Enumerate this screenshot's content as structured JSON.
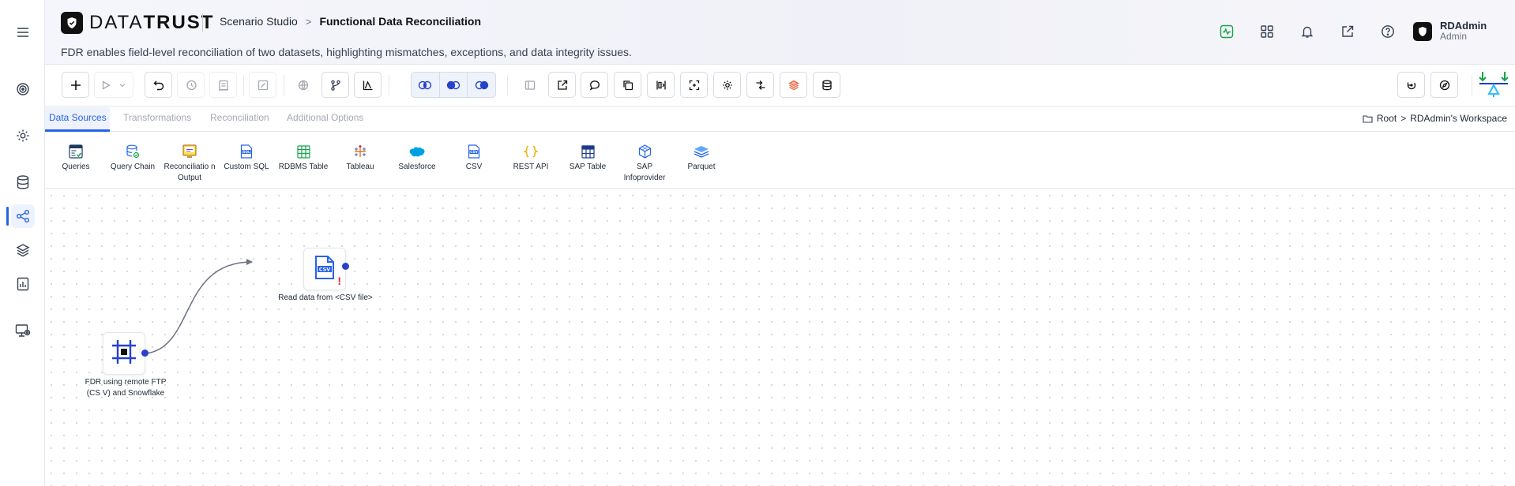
{
  "app": {
    "logo_light": "DATA",
    "logo_bold": "TRUST",
    "breadcrumb_parent": "Scenario Studio",
    "breadcrumb_sep": ">",
    "breadcrumb_current": "Functional Data Reconciliation",
    "subtitle": "FDR enables field-level reconciliation of two datasets, highlighting mismatches, exceptions, and data integrity issues."
  },
  "header_icons": [
    "activity-icon",
    "apps-grid-icon",
    "bell-icon",
    "external-link-icon",
    "help-icon"
  ],
  "user": {
    "name": "RDAdmin",
    "role": "Admin"
  },
  "rail": {
    "items": [
      "target-icon",
      "settings-icon",
      "database-icon",
      "workflow-icon",
      "layers-icon",
      "report-icon",
      "monitor-icon"
    ],
    "active": "workflow-icon"
  },
  "tabs": [
    {
      "label": "Data Sources",
      "active": true
    },
    {
      "label": "Transformations",
      "active": false
    },
    {
      "label": "Reconciliation",
      "active": false
    },
    {
      "label": "Additional Options",
      "active": false
    }
  ],
  "workspace": {
    "root": "Root",
    "sep": ">",
    "name": "RDAdmin's Workspace"
  },
  "palette": [
    {
      "label": "Queries",
      "icon": "queries-icon"
    },
    {
      "label": "Query Chain",
      "icon": "query-chain-icon"
    },
    {
      "label": "Reconciliatio n Output",
      "icon": "recon-output-icon"
    },
    {
      "label": "Custom SQL",
      "icon": "sql-icon"
    },
    {
      "label": "RDBMS Table",
      "icon": "table-icon"
    },
    {
      "label": "Tableau",
      "icon": "tableau-icon"
    },
    {
      "label": "Salesforce",
      "icon": "salesforce-icon"
    },
    {
      "label": "CSV",
      "icon": "csv-icon"
    },
    {
      "label": "REST API",
      "icon": "braces-icon"
    },
    {
      "label": "SAP Table",
      "icon": "sap-table-icon"
    },
    {
      "label": "SAP Infoprovider",
      "icon": "cube-icon"
    },
    {
      "label": "Parquet",
      "icon": "parquet-icon"
    }
  ],
  "nodes": {
    "source": {
      "label": "FDR using remote FTP (CS V) and Snowflake",
      "icon": "frame-icon"
    },
    "csv": {
      "label": "Read data from <CSV file>",
      "icon": "csv-file-icon",
      "warning": "!"
    }
  },
  "colors": {
    "accent": "#2563eb",
    "port": "#2742c9",
    "warning": "#dc2626",
    "balance_green": "#16a34a"
  }
}
